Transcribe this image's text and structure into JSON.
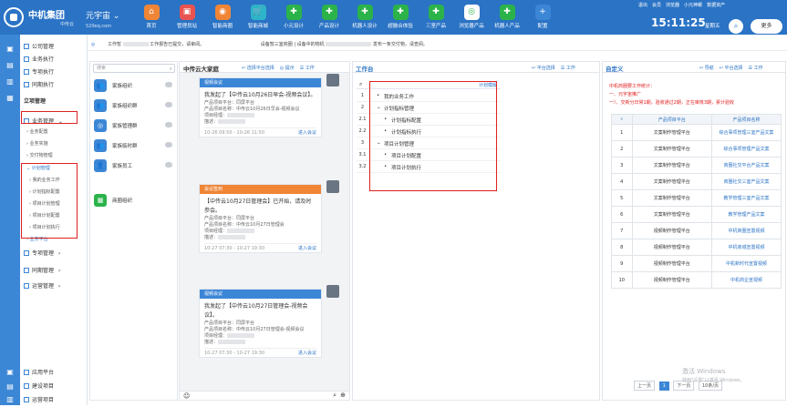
{
  "brand": {
    "name": "中机集团",
    "sub": "中传云",
    "world": "元宇宙",
    "site": "520eq.com"
  },
  "apps": [
    {
      "label": "首页",
      "color": "#f08535",
      "icon": "home-icon",
      "glyph": "⌂"
    },
    {
      "label": "管理员站",
      "color": "#e9534f",
      "icon": "admin-station-icon",
      "glyph": "▣"
    },
    {
      "label": "智能商圈",
      "color": "#f08535",
      "icon": "smart-business-icon",
      "glyph": "◉"
    },
    {
      "label": "智能商城",
      "color": "#2fb3c8",
      "icon": "smart-mall-icon",
      "glyph": "🛒"
    },
    {
      "label": "小元设计",
      "color": "#2bb34a",
      "icon": "xiaoyuan-design-icon",
      "glyph": "✚"
    },
    {
      "label": "产品设计",
      "color": "#2bb34a",
      "icon": "product-design-icon",
      "glyph": "✚"
    },
    {
      "label": "机器人设计",
      "color": "#2bb34a",
      "icon": "robot-design-icon",
      "glyph": "✚"
    },
    {
      "label": "超融合体验",
      "color": "#2bb34a",
      "icon": "hyper-converged-icon",
      "glyph": "✚"
    },
    {
      "label": "三室产品",
      "color": "#2bb34a",
      "icon": "three-room-product-icon",
      "glyph": "✚"
    },
    {
      "label": "浏览器产品",
      "color": "#ffffff",
      "icon": "browser-product-icon",
      "glyph": "◎"
    },
    {
      "label": "机器人产品",
      "color": "#2bb34a",
      "icon": "robot-product-icon",
      "glyph": "✚"
    },
    {
      "label": "配置",
      "color": "#3c86d6",
      "icon": "config-icon",
      "glyph": "+"
    }
  ],
  "toplinks": [
    "退出",
    "会员",
    "浏览器",
    "小元神螺",
    "数据资产"
  ],
  "clock": "15:11:25",
  "weekday": "星期五",
  "more": "更多",
  "nav": {
    "items": [
      {
        "label": "公司管理",
        "sub": false
      },
      {
        "label": "业务执行",
        "sub": false
      },
      {
        "label": "专项执行",
        "sub": false
      },
      {
        "label": "同期执行",
        "sub": false
      },
      {
        "label": "立项管理",
        "sub": false,
        "bold": true
      },
      {
        "label": "业务管理",
        "sub": false,
        "arrow": "⌄"
      },
      {
        "label": "业务配置",
        "sub": true
      },
      {
        "label": "业务实施",
        "sub": true
      },
      {
        "label": "交付物管理",
        "sub": true
      },
      {
        "label": "计划管理",
        "sub": true,
        "blue": true
      },
      {
        "label": "我的业务工作",
        "sub": true
      },
      {
        "label": "计划指标配置",
        "sub": true
      },
      {
        "label": "项目计划管理",
        "sub": true
      },
      {
        "label": "项目计划配置",
        "sub": true
      },
      {
        "label": "项目计划执行",
        "sub": true
      },
      {
        "label": "业务平台",
        "sub": true,
        "blue": true
      },
      {
        "label": "专项管理",
        "sub": false,
        "arrow": "›"
      },
      {
        "label": "同期管理",
        "sub": false,
        "arrow": "›"
      },
      {
        "label": "运营管理",
        "sub": false,
        "arrow": "›"
      }
    ],
    "bottom": [
      "应用平台",
      "建设项目",
      "运营项目"
    ]
  },
  "notice": "工作暂",
  "notice2": "工作报告已提交，请审阅。",
  "notice3": "设备暂三室商圈",
  "notice4": "设备中的物机",
  "notice5": "发布一条交付物，请查阅。",
  "panel1": {
    "search": "搜索",
    "items": [
      {
        "label": "家族组织",
        "color": "#3c86d6",
        "icon": "org-icon",
        "glyph": "👥"
      },
      {
        "label": "家族组织群",
        "color": "#3c86d6",
        "icon": "org-group-icon",
        "glyph": "👥"
      },
      {
        "label": "家族管理群",
        "color": "#3c86d6",
        "icon": "manage-group-icon",
        "glyph": "◎"
      },
      {
        "label": "家族临时群",
        "color": "#3c86d6",
        "icon": "temp-group-icon",
        "glyph": "👥"
      },
      {
        "label": "家族员工",
        "color": "#3c86d6",
        "icon": "staff-icon",
        "glyph": "👤"
      },
      {
        "label": "商圈组织",
        "color": "#2bb34a",
        "icon": "business-org-icon",
        "glyph": "▦"
      }
    ]
  },
  "chat": {
    "title": "中传云大家庭",
    "actions": [
      "↩ 选择平台选择",
      "◎ 提示",
      "☰ 工作"
    ],
    "cards": [
      {
        "header": "视频会议",
        "color": "#3c86d6",
        "msg": "我发起了【中传云10月26日早会-视频会议】。",
        "p1": "产品项目平台：同屏平台",
        "p2": "产品项目名称：中传云10月26日早会-视频会议",
        "p3": "项目经理：",
        "p4": "描述：",
        "time": "10-26 09:50 - 10-26 11:50",
        "go": "进入会议"
      },
      {
        "header": "会议签到",
        "color": "#f08535",
        "msg": "【中传云10月27日管理会】已开始，请及时参会。",
        "p1": "产品项目平台：同屏平台",
        "p2": "产品项目名称：中传云10月27日管理会",
        "p3": "项目经理：",
        "p4": "描述：",
        "time": "10-27 07:30 - 10-27 19:30",
        "go": "进入会议"
      },
      {
        "header": "视频会议",
        "color": "#3c86d6",
        "msg": "我发起了【中传云10月27日管理会-视频会议】。",
        "p1": "产品项目平台：同屏平台",
        "p2": "产品项目名称：中传云10月27日管理会-视频会议",
        "p3": "项目经理：",
        "p4": "描述：",
        "time": "10-27 07:30 - 10-27 19:30",
        "go": "进入会议"
      }
    ]
  },
  "workbench": {
    "title": "工作台",
    "actions": [
      "↩ 平台选择",
      "☰ 工作"
    ],
    "link": "计划模版",
    "rows": [
      {
        "no": "1",
        "text": "我的业务工作",
        "indent": 0,
        "mark": "•"
      },
      {
        "no": "2",
        "text": "计划指标管理",
        "indent": 0,
        "mark": "⌄"
      },
      {
        "no": "2.1",
        "text": "计划指标配置",
        "indent": 1,
        "mark": "•"
      },
      {
        "no": "2.2",
        "text": "计划指标执行",
        "indent": 1,
        "mark": "•"
      },
      {
        "no": "3",
        "text": "项目计划管理",
        "indent": 0,
        "mark": "⌄"
      },
      {
        "no": "3.1",
        "text": "项目计划配置",
        "indent": 1,
        "mark": "•"
      },
      {
        "no": "3.2",
        "text": "项目计划执行",
        "indent": 1,
        "mark": "•"
      }
    ]
  },
  "custom": {
    "title": "自定义",
    "actions": [
      "↩ 导航",
      "↩ 平台选择",
      "☰ 工作"
    ],
    "notice": [
      "中机商圈要工作统计：",
      "一、元宇宙推广",
      "一）、交新分日常1期，验收通过2期，正在审核3期，累计验收"
    ],
    "headers": [
      "产品项目平台",
      "产品项目名称"
    ],
    "rows": [
      {
        "no": "1",
        "platform": "文案制作管理平台",
        "name": "综合事项管理三室产品文案"
      },
      {
        "no": "2",
        "platform": "文案制作管理平台",
        "name": "综合事项管理产品文案"
      },
      {
        "no": "3",
        "platform": "文案制作管理平台",
        "name": "商圈社交平台产品文案"
      },
      {
        "no": "4",
        "platform": "文案制作管理平台",
        "name": "商圈社交三室产品文案"
      },
      {
        "no": "5",
        "platform": "文案制作管理平台",
        "name": "教学管理三室产品文案"
      },
      {
        "no": "6",
        "platform": "文案制作管理平台",
        "name": "教学管理产品文案"
      },
      {
        "no": "7",
        "platform": "视频制作管理平台",
        "name": "中机商圈宣置视频"
      },
      {
        "no": "8",
        "platform": "视频制作管理平台",
        "name": "中机商城宣置视频"
      },
      {
        "no": "9",
        "platform": "视频制作管理平台",
        "name": "中机新时代宣置视频"
      },
      {
        "no": "10",
        "platform": "视频制作管理平台",
        "name": "中机商企宣视频"
      }
    ],
    "pager": {
      "prev": "上一页",
      "page": "1",
      "next": "下一页",
      "size": "10条/页"
    }
  },
  "watermark": "激活 Windows",
  "watermark2": "转到\"设置\"以激活 Windows。"
}
